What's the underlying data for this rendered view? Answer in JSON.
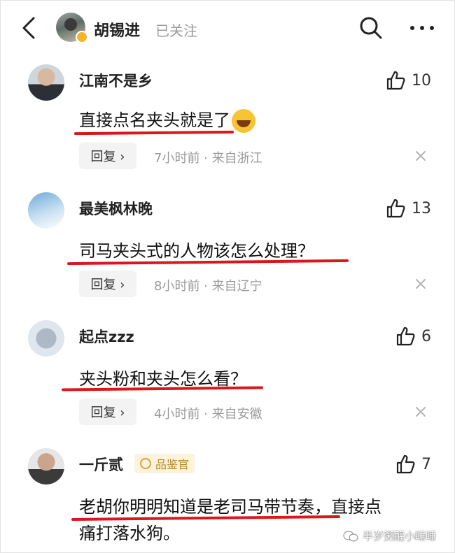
{
  "header": {
    "title": "胡锡进",
    "follow_status": "已关注",
    "icons": [
      "back-arrow-icon",
      "search-icon",
      "more-icon"
    ]
  },
  "comments": [
    {
      "user": "江南不是乡",
      "likes": "10",
      "text": "直接点名夹头就是了",
      "emoji": "laughing-emoji",
      "reply_label": "回复 ›",
      "meta": "7小时前 · 来自浙江"
    },
    {
      "user": "最美枫林晚",
      "likes": "13",
      "text": "司马夹头式的人物该怎么处理？",
      "reply_label": "回复 ›",
      "meta": "8小时前 · 来自辽宁"
    },
    {
      "user": "起点zzz",
      "likes": "6",
      "text": "夹头粉和夹头怎么看？",
      "reply_label": "回复 ›",
      "meta": "4小时前 · 来自安徽"
    },
    {
      "user": "一斤贰",
      "badge": "品鉴官",
      "likes": "7",
      "text_line1": "老胡你明明知道是老司马带节奏，直接点",
      "text_line2": "痛打落水狗。"
    }
  ],
  "watermark": "半岁粥醒小睡睡",
  "colors": {
    "underline": "#d8181c",
    "meta": "#9a9a9a",
    "badge_bg": "#fdf3dc",
    "badge_text": "#b8862e"
  }
}
